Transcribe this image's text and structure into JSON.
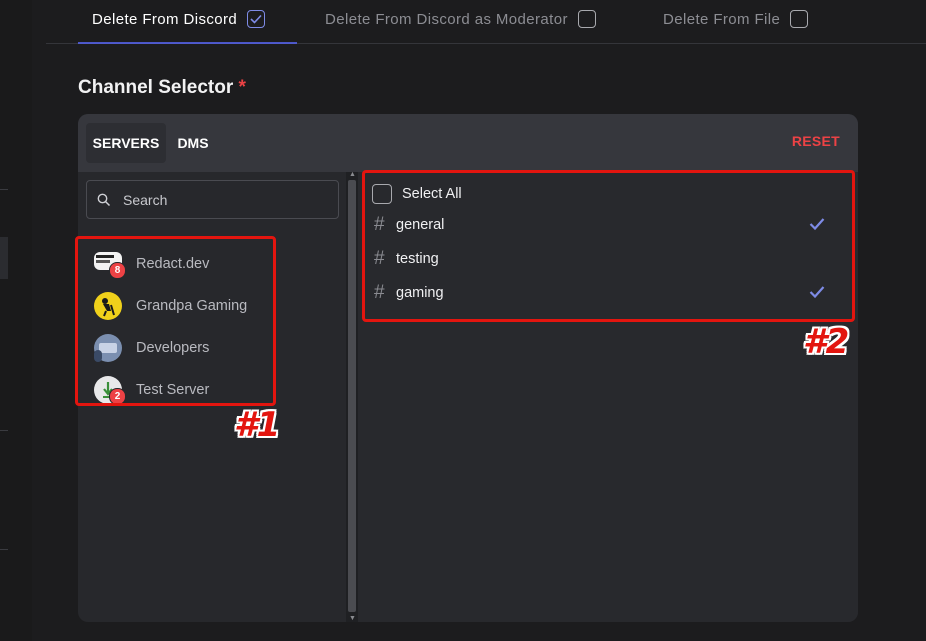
{
  "mode_tabs": [
    {
      "label": "Delete From Discord",
      "checked": true
    },
    {
      "label": "Delete From Discord as Moderator",
      "checked": false
    },
    {
      "label": "Delete From File",
      "checked": false
    }
  ],
  "section": {
    "title": "Channel Selector",
    "required_mark": "*"
  },
  "panel": {
    "tabs": [
      {
        "label": "SERVERS",
        "selected": true
      },
      {
        "label": "DMS",
        "selected": false
      }
    ],
    "reset_label": "RESET",
    "search": {
      "placeholder": "Search",
      "value": ""
    },
    "servers": [
      {
        "name": "Redact.dev",
        "badge": "8",
        "icon": "redact-logo-icon"
      },
      {
        "name": "Grandpa Gaming",
        "badge": "",
        "icon": "grandpa-gaming-icon"
      },
      {
        "name": "Developers",
        "badge": "",
        "icon": "developers-icon"
      },
      {
        "name": "Test Server",
        "badge": "2",
        "icon": "test-server-icon"
      }
    ],
    "select_all_label": "Select All",
    "channels": [
      {
        "name": "general",
        "selected": true
      },
      {
        "name": "testing",
        "selected": false
      },
      {
        "name": "gaming",
        "selected": true
      }
    ]
  },
  "annotations": {
    "callout_1": "#1",
    "callout_2": "#2"
  },
  "colors": {
    "accent": "#5865f2",
    "danger": "#ed4245",
    "annotation": "#e3150f",
    "check": "#7e8be6"
  }
}
